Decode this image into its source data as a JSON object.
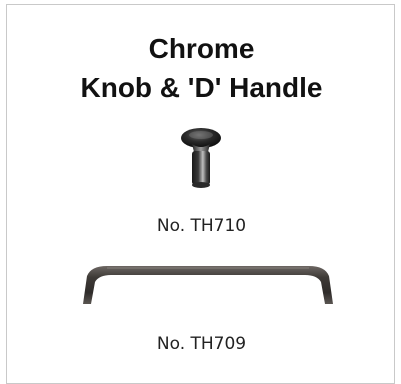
{
  "title": {
    "line1": "Chrome",
    "line2": "Knob & 'D' Handle"
  },
  "products": [
    {
      "code": "No. TH710",
      "image": "chrome-knob"
    },
    {
      "code": "No. TH709",
      "image": "d-handle"
    }
  ],
  "colors": {
    "border": "#c9c9c9",
    "text": "#111111",
    "metal_dark": "#2a2a2a",
    "metal_light": "#8a8a8a"
  }
}
